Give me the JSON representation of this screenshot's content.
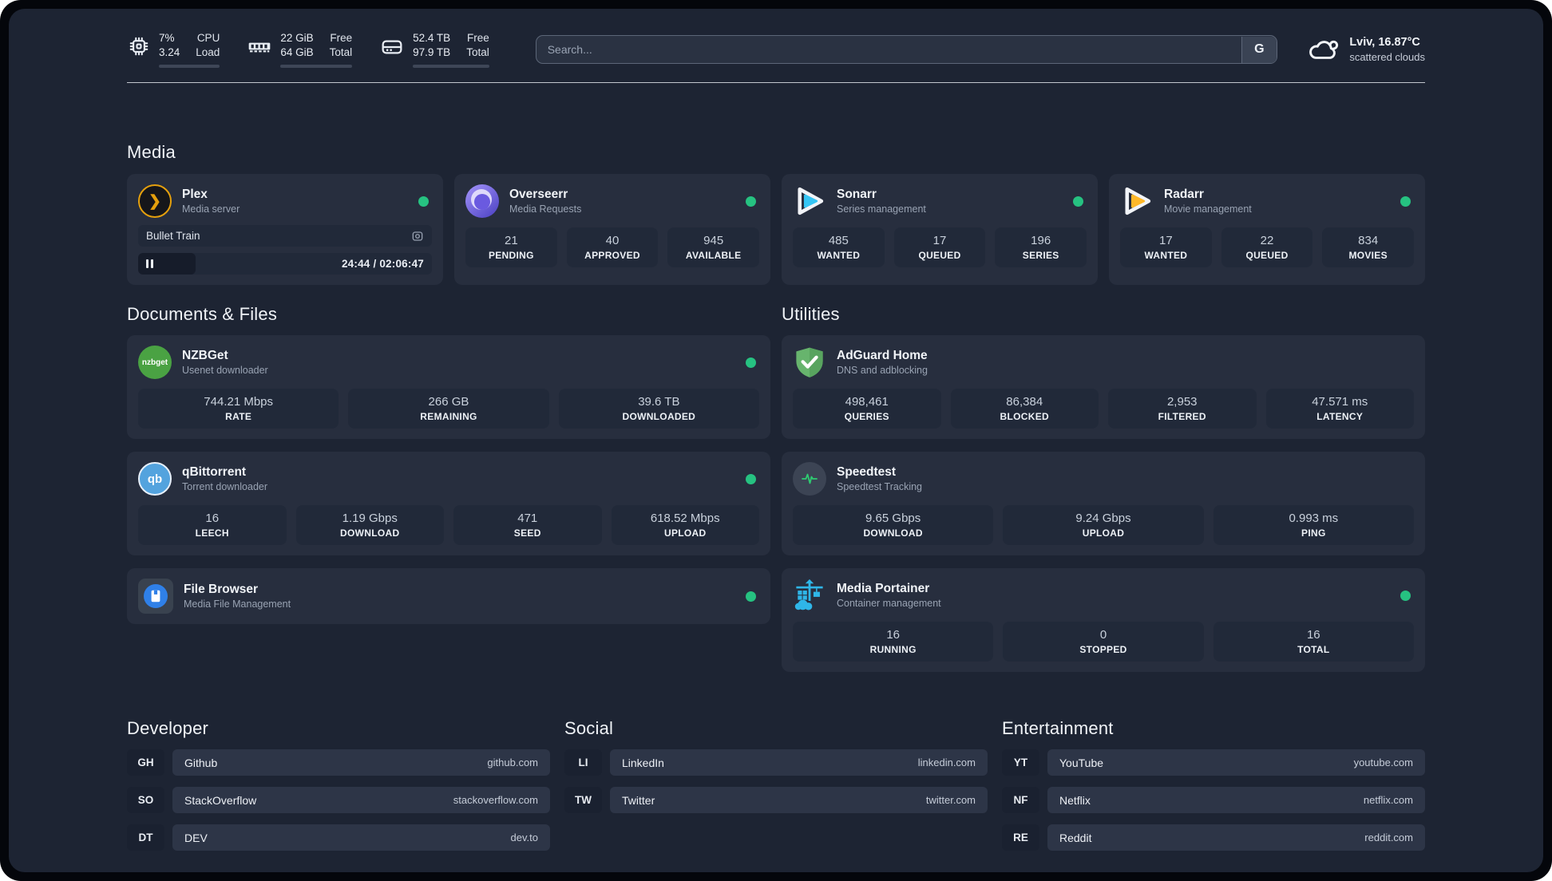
{
  "colors": {
    "page_bg": "#1d2433",
    "card_bg": "#272e3e",
    "stat_bg": "#212939",
    "status_online": "#26c281",
    "plex_accent": "#e5a00d",
    "sonarr_accent": "#35c5f4",
    "radarr_accent": "#ffb829",
    "nzbget_accent": "#4aa243",
    "qbittorrent_accent": "#53a3de",
    "adguard_accent": "#67b46d",
    "speedtest_accent": "#2ecc71",
    "portainer_accent": "#2fb6e8",
    "filebrowser_accent": "#2f80e8"
  },
  "header": {
    "cpu": {
      "values": [
        "7%",
        "3.24"
      ],
      "labels": [
        "CPU",
        "Load"
      ],
      "progress_pct": 7
    },
    "memory": {
      "values": [
        "22 GiB",
        "64 GiB"
      ],
      "labels": [
        "Free",
        "Total"
      ],
      "progress_pct": 66
    },
    "disk": {
      "values": [
        "52.4 TB",
        "97.9 TB"
      ],
      "labels": [
        "Free",
        "Total"
      ],
      "progress_pct": 47
    },
    "search": {
      "placeholder": "Search...",
      "button_label": "G"
    },
    "weather": {
      "location_temp": "Lviv, 16.87°C",
      "condition": "scattered clouds"
    }
  },
  "sections": {
    "media": "Media",
    "documents": "Documents & Files",
    "utilities": "Utilities",
    "developer": "Developer",
    "social": "Social",
    "entertainment": "Entertainment"
  },
  "apps": {
    "plex": {
      "name": "Plex",
      "description": "Media server",
      "online": true,
      "now_playing": {
        "title": "Bullet Train",
        "time_display": "24:44 / 02:06:47",
        "elapsed": "24:44",
        "duration": "02:06:47",
        "progress_pct": 19.5
      }
    },
    "overseerr": {
      "name": "Overseerr",
      "description": "Media Requests",
      "online": true,
      "stats": [
        {
          "value": "21",
          "label": "PENDING"
        },
        {
          "value": "40",
          "label": "APPROVED"
        },
        {
          "value": "945",
          "label": "AVAILABLE"
        }
      ]
    },
    "sonarr": {
      "name": "Sonarr",
      "description": "Series management",
      "online": true,
      "stats": [
        {
          "value": "485",
          "label": "WANTED"
        },
        {
          "value": "17",
          "label": "QUEUED"
        },
        {
          "value": "196",
          "label": "SERIES"
        }
      ]
    },
    "radarr": {
      "name": "Radarr",
      "description": "Movie management",
      "online": true,
      "stats": [
        {
          "value": "17",
          "label": "WANTED"
        },
        {
          "value": "22",
          "label": "QUEUED"
        },
        {
          "value": "834",
          "label": "MOVIES"
        }
      ]
    },
    "nzbget": {
      "name": "NZBGet",
      "description": "Usenet downloader",
      "online": true,
      "icon_text": "nzbget",
      "stats": [
        {
          "value": "744.21 Mbps",
          "label": "RATE"
        },
        {
          "value": "266 GB",
          "label": "REMAINING"
        },
        {
          "value": "39.6 TB",
          "label": "DOWNLOADED"
        }
      ]
    },
    "qbittorrent": {
      "name": "qBittorrent",
      "description": "Torrent downloader",
      "online": true,
      "icon_text": "qb",
      "stats": [
        {
          "value": "16",
          "label": "LEECH"
        },
        {
          "value": "1.19 Gbps",
          "label": "DOWNLOAD"
        },
        {
          "value": "471",
          "label": "SEED"
        },
        {
          "value": "618.52 Mbps",
          "label": "UPLOAD"
        }
      ]
    },
    "filebrowser": {
      "name": "File Browser",
      "description": "Media File Management",
      "online": true
    },
    "adguard": {
      "name": "AdGuard Home",
      "description": "DNS and adblocking",
      "stats": [
        {
          "value": "498,461",
          "label": "QUERIES"
        },
        {
          "value": "86,384",
          "label": "BLOCKED"
        },
        {
          "value": "2,953",
          "label": "FILTERED"
        },
        {
          "value": "47.571 ms",
          "label": "LATENCY"
        }
      ]
    },
    "speedtest": {
      "name": "Speedtest",
      "description": "Speedtest Tracking",
      "stats": [
        {
          "value": "9.65 Gbps",
          "label": "DOWNLOAD"
        },
        {
          "value": "9.24 Gbps",
          "label": "UPLOAD"
        },
        {
          "value": "0.993 ms",
          "label": "PING"
        }
      ]
    },
    "portainer": {
      "name": "Media Portainer",
      "description": "Container management",
      "online": true,
      "stats": [
        {
          "value": "16",
          "label": "RUNNING"
        },
        {
          "value": "0",
          "label": "STOPPED"
        },
        {
          "value": "16",
          "label": "TOTAL"
        }
      ]
    }
  },
  "links": {
    "developer": [
      {
        "code": "GH",
        "name": "Github",
        "url": "github.com"
      },
      {
        "code": "SO",
        "name": "StackOverflow",
        "url": "stackoverflow.com"
      },
      {
        "code": "DT",
        "name": "DEV",
        "url": "dev.to"
      }
    ],
    "social": [
      {
        "code": "LI",
        "name": "LinkedIn",
        "url": "linkedin.com"
      },
      {
        "code": "TW",
        "name": "Twitter",
        "url": "twitter.com"
      }
    ],
    "entertainment": [
      {
        "code": "YT",
        "name": "YouTube",
        "url": "youtube.com"
      },
      {
        "code": "NF",
        "name": "Netflix",
        "url": "netflix.com"
      },
      {
        "code": "RE",
        "name": "Reddit",
        "url": "reddit.com"
      }
    ]
  }
}
